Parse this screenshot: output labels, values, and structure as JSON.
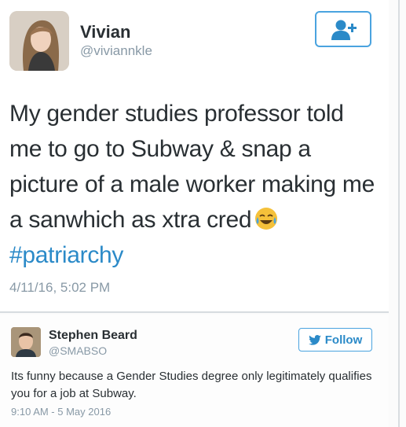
{
  "main_tweet": {
    "name": "Vivian",
    "handle": "@viviannkle",
    "text": "My gender studies professor told me to go to Subway & snap a picture of a male worker making me a sanwhich as xtra cred",
    "emoji_icon": "face-with-tears-of-joy-icon",
    "hashtag": "#patriarchy",
    "timestamp": "4/11/16, 5:02 PM",
    "follow_icon": "add-user-icon"
  },
  "reply_tweet": {
    "name": "Stephen Beard",
    "handle": "@SMABSO",
    "follow_label": "Follow",
    "follow_icon": "twitter-bird-icon",
    "text": "Its funny because a Gender Studies degree only legitimately qualifies you for a job at Subway.",
    "timestamp": "9:10 AM - 5 May 2016"
  },
  "colors": {
    "accent": "#2b8ac8",
    "border_blue": "#4aa3df",
    "text": "#292f33",
    "muted": "#8899a6"
  }
}
